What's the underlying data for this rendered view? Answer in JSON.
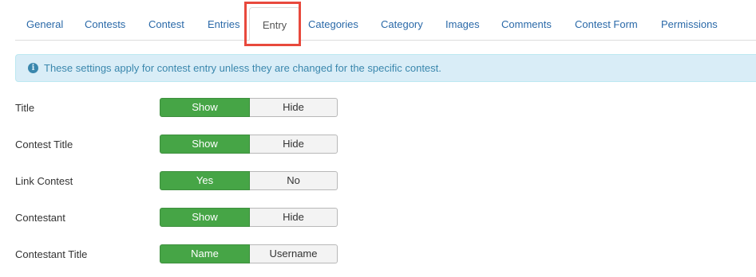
{
  "tabs": [
    {
      "label": "General"
    },
    {
      "label": "Contests"
    },
    {
      "label": "Contest"
    },
    {
      "label": "Entries"
    },
    {
      "label": "Entry"
    },
    {
      "label": "Categories"
    },
    {
      "label": "Category"
    },
    {
      "label": "Images"
    },
    {
      "label": "Comments"
    },
    {
      "label": "Contest Form"
    },
    {
      "label": "Permissions"
    }
  ],
  "active_tab": "Entry",
  "alert": {
    "icon": "info-circle-icon",
    "message": "These settings apply for contest entry unless they are changed for the specific contest."
  },
  "settings": [
    {
      "label": "Title",
      "on": "Show",
      "off": "Hide",
      "selected": "Show"
    },
    {
      "label": "Contest Title",
      "on": "Show",
      "off": "Hide",
      "selected": "Show"
    },
    {
      "label": "Link Contest",
      "on": "Yes",
      "off": "No",
      "selected": "Yes"
    },
    {
      "label": "Contestant",
      "on": "Show",
      "off": "Hide",
      "selected": "Show"
    },
    {
      "label": "Contestant Title",
      "on": "Name",
      "off": "Username",
      "selected": "Name"
    }
  ],
  "colors": {
    "tab_link": "#2a69a8",
    "highlight_border": "#e8493d",
    "alert_bg": "#d9edf7",
    "alert_text": "#3a87ad",
    "selected_green": "#46a546"
  }
}
